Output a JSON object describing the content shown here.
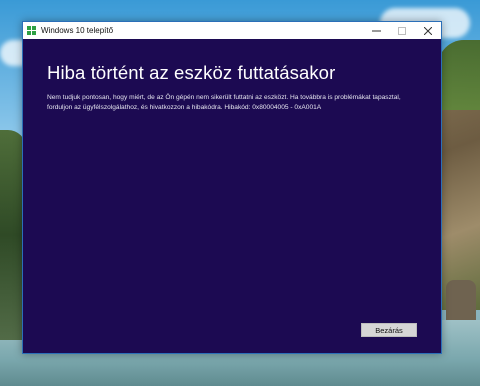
{
  "window": {
    "title": "Windows 10 telepítő",
    "controls": {
      "minimize": "—",
      "maximize": "☐",
      "close": "✕"
    }
  },
  "content": {
    "heading": "Hiba történt az eszköz futtatásakor",
    "message": "Nem tudjuk pontosan, hogy miért, de az Ön gépén nem sikerült futtatni az eszközt. Ha továbbra is problémákat tapasztal, forduljon az ügyfélszolgálathoz, és hivatkozzon a hibakódra. Hibakód: 0x80004005 - 0xA001A"
  },
  "footer": {
    "close_label": "Bezárás"
  },
  "colors": {
    "window_background": "#1c0a52",
    "titlebar": "#ffffff",
    "accent_icon": "#2ea043"
  }
}
